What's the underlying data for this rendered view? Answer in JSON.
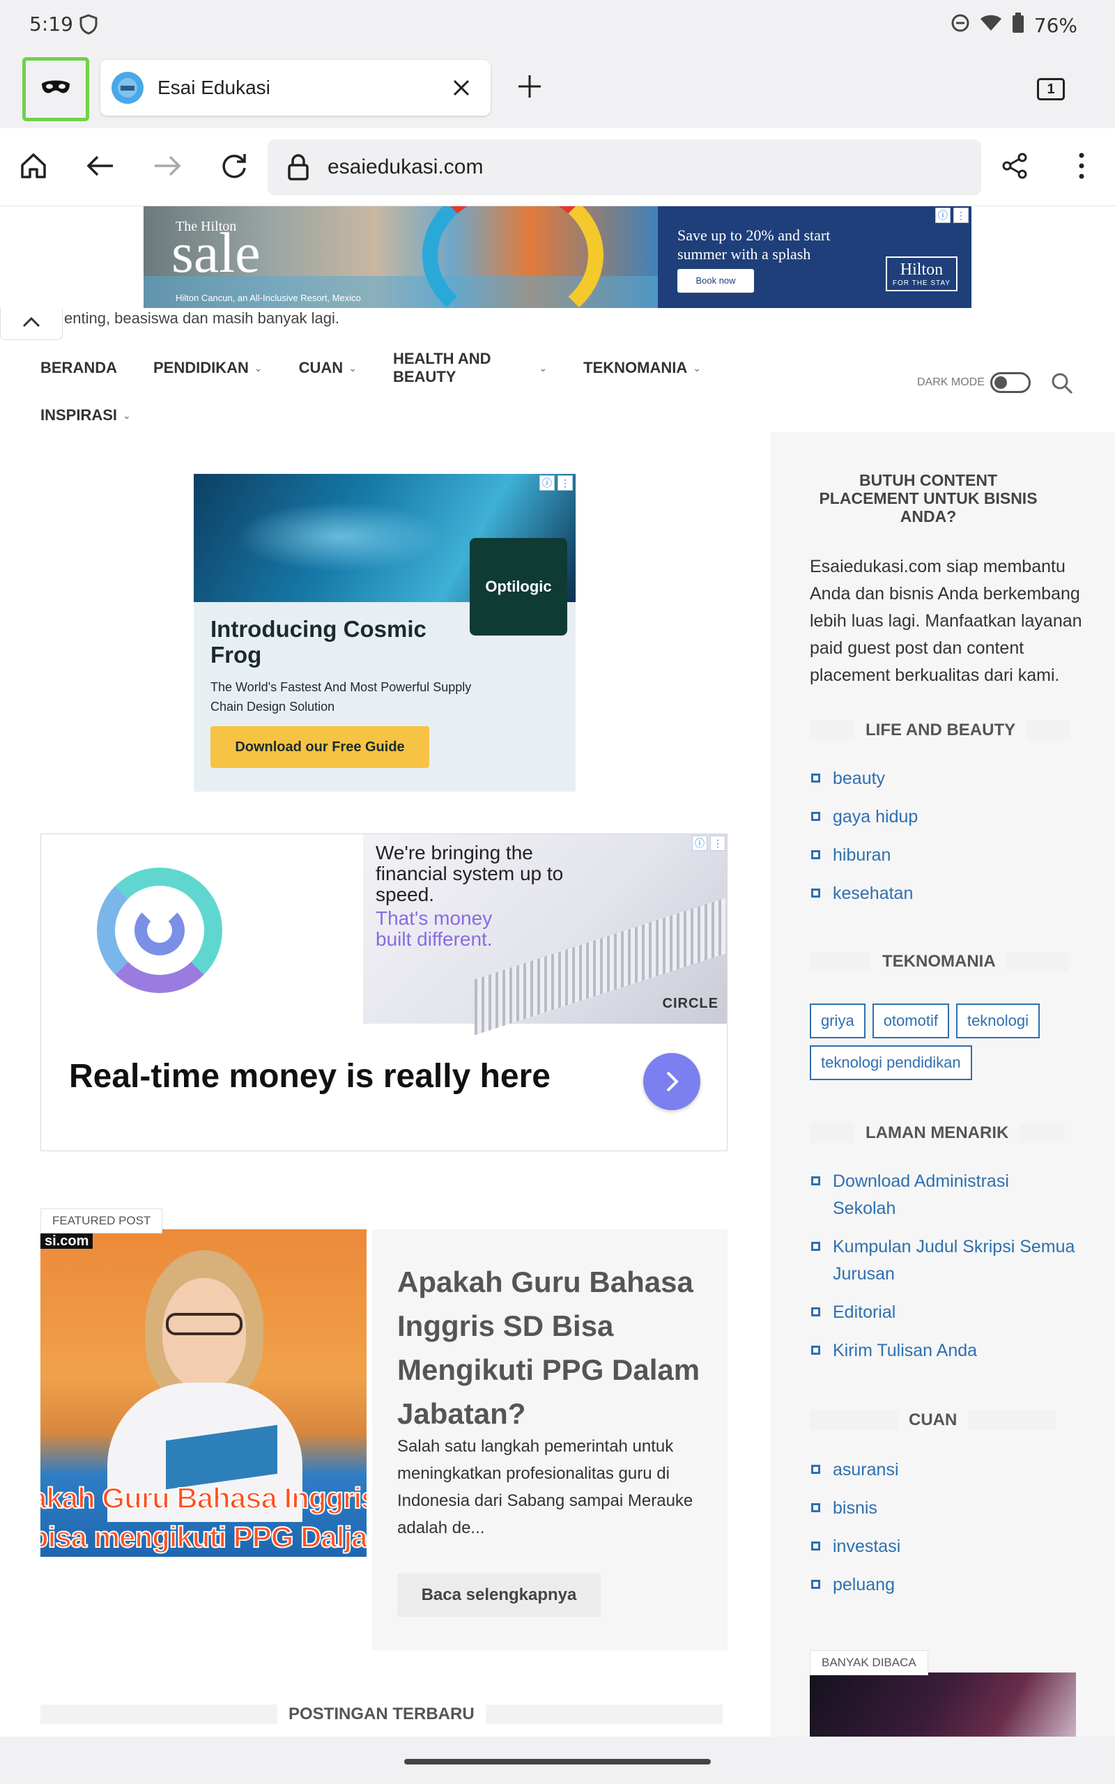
{
  "status_bar": {
    "time": "5:19",
    "battery": "76%"
  },
  "tabs": {
    "active_title": "Esai Edukasi",
    "count": "1"
  },
  "toolbar": {
    "url": "esaiedukasi.com"
  },
  "top_ad": {
    "small": "The Hilton",
    "big": "sale",
    "location": "Hilton Cancun, an All-Inclusive Resort, Mexico",
    "headline": "Save up to 20% and start summer with a splash",
    "button": "Book now",
    "brand": "Hilton",
    "brand_tag": "FOR THE STAY"
  },
  "page": {
    "excerpt": "enting, beasiswa dan masih banyak lagi.",
    "nav_row1": [
      {
        "label": "BERANDA",
        "dropdown": false
      },
      {
        "label": "PENDIDIKAN",
        "dropdown": true
      },
      {
        "label": "CUAN",
        "dropdown": true
      },
      {
        "label": "HEALTH AND BEAUTY",
        "dropdown": true
      },
      {
        "label": "TEKNOMANIA",
        "dropdown": true
      }
    ],
    "nav_row2": [
      {
        "label": "INSPIRASI",
        "dropdown": true
      }
    ],
    "dark_mode_label": "DARK MODE"
  },
  "ad_frog": {
    "brand": "Optilogic",
    "headline": "Introducing Cosmic Frog",
    "sub": "The World's Fastest And Most Powerful Supply Chain Design Solution",
    "cta": "Download our Free Guide"
  },
  "ad_circle": {
    "copy": "We're bringing the financial system up to speed.",
    "copy2": "That's money built different.",
    "brand": "CIRCLE",
    "headline": "Real-time money is really here"
  },
  "featured": {
    "tag": "FEATURED POST",
    "thumb_domain": "si.com",
    "thumb_caption1": "akah Guru Bahasa Inggris",
    "thumb_caption2": "bisa mengikuti PPG Dalja",
    "title": "Apakah Guru Bahasa Inggris SD Bisa Mengikuti PPG Dalam Jabatan?",
    "description": "Salah satu langkah pemerintah untuk meningkatkan profesionalitas guru di Indonesia dari Sabang sampai Merauke adalah de...",
    "read_more": "Baca selengkapnya"
  },
  "latest_heading": "POSTINGAN TERBARU",
  "sidebar": {
    "promo_title": "BUTUH CONTENT PLACEMENT UNTUK BISNIS ANDA?",
    "promo_text": "Esaiedukasi.com siap membantu Anda dan bisnis Anda berkembang lebih luas lagi. Manfaatkan layanan paid guest post dan content placement berkualitas dari kami.",
    "life_heading": "LIFE AND BEAUTY",
    "life_items": [
      "beauty",
      "gaya hidup",
      "hiburan",
      "kesehatan"
    ],
    "tekno_heading": "TEKNOMANIA",
    "tekno_chips": [
      "griya",
      "otomotif",
      "teknologi",
      "teknologi pendidikan"
    ],
    "laman_heading": "LAMAN MENARIK",
    "laman_items": [
      "Download Administrasi Sekolah",
      "Kumpulan Judul Skripsi Semua Jurusan",
      "Editorial",
      "Kirim Tulisan Anda"
    ],
    "cuan_heading": "CUAN",
    "cuan_items": [
      "asuransi",
      "bisnis",
      "investasi",
      "peluang"
    ],
    "popular_tag": "BANYAK DIBACA"
  }
}
